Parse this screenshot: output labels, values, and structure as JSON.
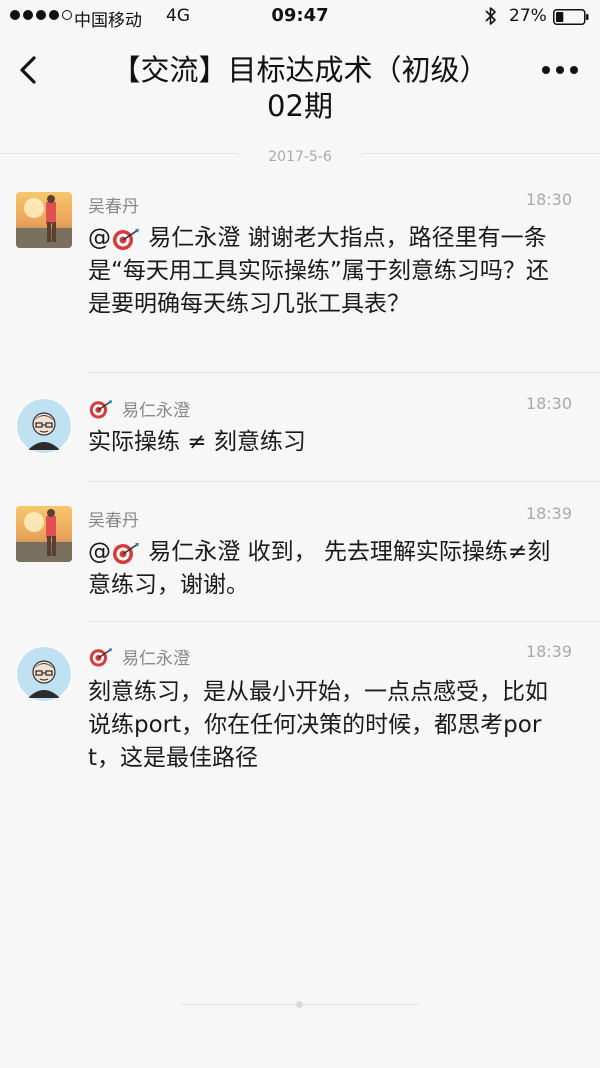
{
  "status_bar": {
    "signal_icon": "signal-dots-icon",
    "carrier": "中国移动",
    "network": "4G",
    "time": "09:47",
    "bluetooth_icon": "bluetooth-icon",
    "battery_percent": "27%",
    "battery_level": 0.27
  },
  "nav": {
    "back_icon": "chevron-left-icon",
    "title_line1": "【交流】目标达成术（初级）",
    "title_line2": "02期",
    "more_icon": "ellipsis-icon"
  },
  "date_separator": "2017-5-6",
  "messages": [
    {
      "sender": "吴春丹",
      "time": "18:30",
      "avatar": "photo-avatar",
      "mention_prefix": "@",
      "mention_name": " 易仁永澄",
      "text": " 谢谢老大指点，路径里有一条是“每天用工具实际操练”属于刻意练习吗？还是要明确每天练习几张工具表？"
    },
    {
      "sender": "易仁永澄",
      "time": "18:30",
      "avatar": "cartoon-avatar",
      "text": "实际操练 ≠ 刻意练习"
    },
    {
      "sender": "吴春丹",
      "time": "18:39",
      "avatar": "photo-avatar",
      "mention_prefix": "@",
      "mention_name": " 易仁永澄",
      "text": " 收到， 先去理解实际操练≠刻意练习，谢谢。"
    },
    {
      "sender": "易仁永澄",
      "time": "18:39",
      "avatar": "cartoon-avatar",
      "text": "刻意练习，是从最小开始，一点点感受，比如说练port，你在任何决策的时候，都思考port，这是最佳路径"
    }
  ],
  "colors": {
    "background": "#f7f7f7",
    "text": "#1a1a1a",
    "meta": "#aaaaaa",
    "target_red": "#d83a3a"
  }
}
